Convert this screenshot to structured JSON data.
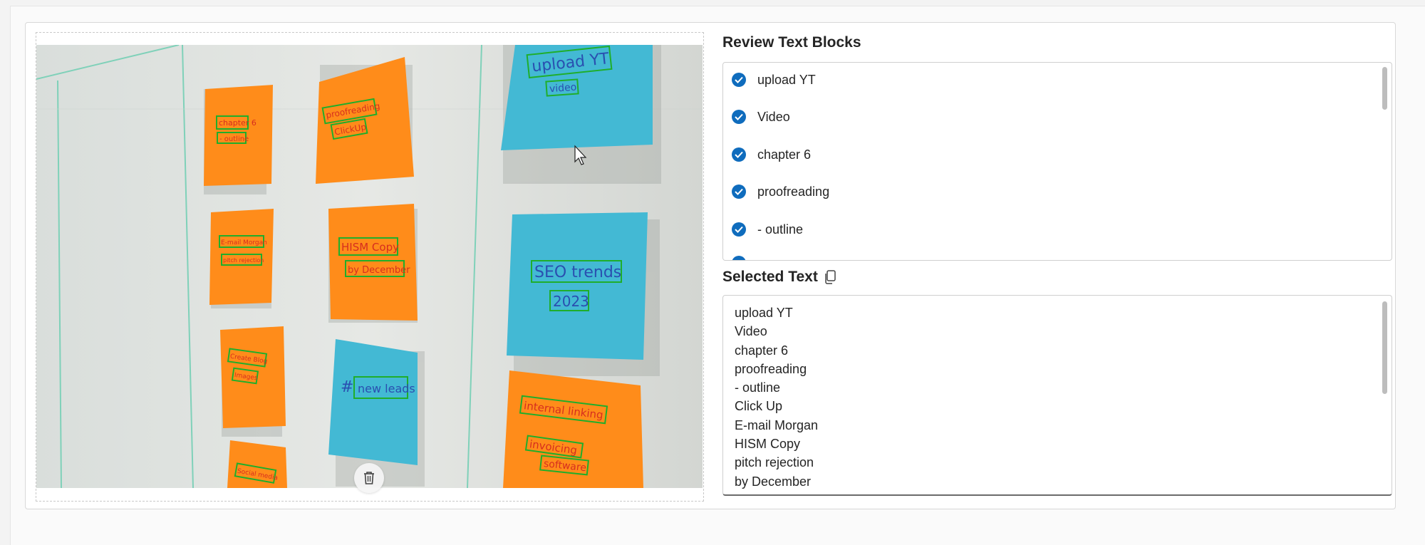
{
  "review": {
    "title": "Review Text Blocks",
    "items": [
      "upload YT",
      "Video",
      "chapter 6",
      "proofreading",
      "- outline"
    ]
  },
  "selected": {
    "title": "Selected Text",
    "lines": [
      "upload YT",
      "Video",
      "chapter 6",
      "proofreading",
      "- outline",
      "Click Up",
      "E-mail Morgan",
      "HISM Copy",
      "pitch rejection",
      "by December"
    ]
  },
  "notes": {
    "n1a": "chapter 6",
    "n1b": "- outline",
    "n2a": "proofreading",
    "n2b": "ClickUp",
    "n3a": "upload YT",
    "n3b": "video",
    "n4a": "E-mail Morgan",
    "n4b": "pitch rejection",
    "n5a": "HISM Copy",
    "n5b": "by December",
    "n6a": "SEO trends",
    "n6b": "2023",
    "n7a": "Create Blog",
    "n7b": "Images",
    "n8a": "#",
    "n8b": "new leads",
    "n9a": "internal linking",
    "n9b": "invoicing",
    "n9c": "software",
    "n10a": "Social media"
  },
  "colors": {
    "accent": "#0f6cbd",
    "orange_note": "#ff8c1a",
    "blue_note": "#43b9d4",
    "detect_box": "#1fae2b"
  },
  "icons": {
    "check": "check-circle-icon",
    "copy": "copy-icon",
    "delete": "trash-icon",
    "cursor": "mouse-cursor-icon"
  }
}
